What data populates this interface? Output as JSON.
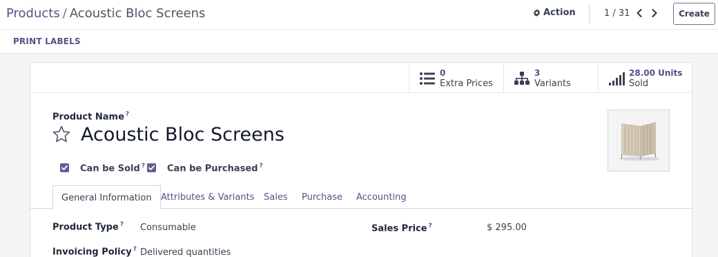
{
  "breadcrumb": {
    "parent": "Products",
    "separator": "/",
    "current": "Acoustic Bloc Screens"
  },
  "header": {
    "action_label": "Action",
    "pager": "1 / 31",
    "create_label": "Create"
  },
  "toolbar": {
    "print_labels": "PRINT LABELS"
  },
  "smart_buttons": [
    {
      "value": "0",
      "label": "Extra Prices",
      "icon": "list-icon"
    },
    {
      "value": "3",
      "label": "Variants",
      "icon": "hierarchy-icon"
    },
    {
      "value": "28.00 Units",
      "label": "Sold",
      "icon": "signal-bars-icon"
    }
  ],
  "product": {
    "name_label": "Product Name",
    "help_mark": "?",
    "name": "Acoustic Bloc Screens",
    "can_be_sold_label": "Can be Sold",
    "can_be_sold": true,
    "can_be_purchased_label": "Can be Purchased",
    "can_be_purchased": true
  },
  "tabs": [
    {
      "label": "General Information",
      "active": true
    },
    {
      "label": "Attributes & Variants",
      "active": false
    },
    {
      "label": "Sales",
      "active": false
    },
    {
      "label": "Purchase",
      "active": false
    },
    {
      "label": "Accounting",
      "active": false
    }
  ],
  "general": {
    "product_type_label": "Product Type",
    "product_type": "Consumable",
    "invoicing_policy_label": "Invoicing Policy",
    "invoicing_policy": "Delivered quantities",
    "sales_price_label": "Sales Price",
    "sales_price": "$ 295.00"
  },
  "colors": {
    "accent": "#5b4d8a",
    "checkbox": "#6b5b95",
    "text": "#374151"
  }
}
